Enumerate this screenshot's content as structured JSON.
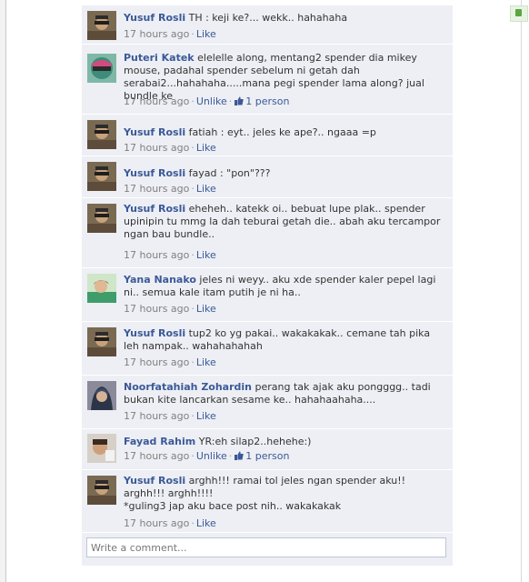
{
  "comments": [
    {
      "author": "Yusuf Rosli",
      "text": "TH : keji ke?... wekk.. hahahaha",
      "time": "17 hours ago",
      "action": "Like"
    },
    {
      "author": "Puteri Katek",
      "text": "elelelle along, mentang2 spender dia mikey mouse, padahal spender sebelum ni getah dah serabai2...hahahaha.....mana pegi spender lama along? jual bundle ke",
      "time": "17 hours ago",
      "action": "Unlike",
      "likes": "1 person"
    },
    {
      "author": "Yusuf Rosli",
      "text": "fatiah : eyt.. jeles ke ape?.. ngaaa =p",
      "time": "17 hours ago",
      "action": "Like"
    },
    {
      "author": "Yusuf Rosli",
      "text": "fayad : \"pon\"???",
      "time": "17 hours ago",
      "action": "Like"
    },
    {
      "author": "Yusuf Rosli",
      "text": "eheheh.. katekk oi.. bebuat lupe plak.. spender upinipin tu mmg la dah teburai getah die.. abah aku tercampor ngan bau bundle..",
      "time": "17 hours ago",
      "action": "Like"
    },
    {
      "author": "Yana Nanako",
      "text": "jeles ni weyy.. aku xde spender kaler pepel lagi ni.. semua kale itam putih je ni ha..",
      "time": "17 hours ago",
      "action": "Like"
    },
    {
      "author": "Yusuf Rosli",
      "text": "tup2 ko yg pakai.. wakakakak.. cemane tah pika leh nampak.. wahahahahah",
      "time": "17 hours ago",
      "action": "Like"
    },
    {
      "author": "Noorfatahiah Zohardin",
      "text": "perang tak ajak aku pongggg.. tadi bukan kite lancarkan sesame ke.. hahahaahaha....",
      "time": "17 hours ago",
      "action": "Like"
    },
    {
      "author": "Fayad Rahim",
      "text": "YR:eh silap2..hehehe:)",
      "time": "17 hours ago",
      "action": "Unlike",
      "likes": "1 person"
    },
    {
      "author": "Yusuf Rosli",
      "text": "arghh!!! ramai tol jeles ngan spender aku!! arghh!!! arghh!!!!",
      "text2": "*guling3 jap aku bace post nih.. wakakakak",
      "time": "17 hours ago",
      "action": "Like"
    }
  ],
  "write_comment": {
    "placeholder": "Write a comment..."
  },
  "colors": {
    "link": "#3b5998",
    "comment_bg": "#edeff4",
    "meta": "#808080"
  }
}
